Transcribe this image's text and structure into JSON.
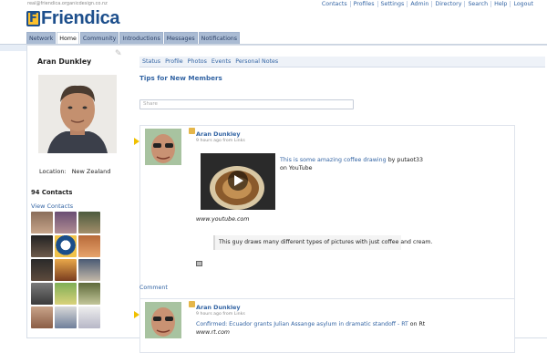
{
  "header": {
    "user_email": "real@friendica.organicdesign.co.nz",
    "logo_letter": "F",
    "logo_text": "Friendica"
  },
  "topnav": [
    "Contacts",
    "Profiles",
    "Settings",
    "Admin",
    "Directory",
    "Search",
    "Help",
    "Logout"
  ],
  "tabs": [
    {
      "label": "Network",
      "active": false
    },
    {
      "label": "Home",
      "active": true
    },
    {
      "label": "Community",
      "active": false
    },
    {
      "label": "Introductions",
      "active": false
    },
    {
      "label": "Messages",
      "active": false
    },
    {
      "label": "Notifications",
      "active": false
    }
  ],
  "profile": {
    "name": "Aran Dunkley",
    "location_label": "Location:",
    "location_value": "New Zealand",
    "contacts_count": "94 Contacts",
    "view_contacts": "View Contacts"
  },
  "subtabs": [
    "Status",
    "Profile",
    "Photos",
    "Events",
    "Personal Notes"
  ],
  "tips": "Tips for New Members",
  "share_placeholder": "Share",
  "posts": [
    {
      "author": "Aran Dunkley",
      "ago": "9 hours ago from Links",
      "video_title": "This is some amazing coffee drawing",
      "video_by": " by putaot33 on YouTube",
      "url": "www.youtube.com",
      "quote": "This guy draws many different types of pictures with just coffee and cream."
    },
    {
      "author": "Aran Dunkley",
      "ago": "9 hours ago from Links",
      "link": "Confirmed: Ecuador grants Julian Assange asylum in dramatic standoff - RT",
      "link_suffix": " on Rt",
      "url": "www.rt.com"
    }
  ],
  "comment_label": "Comment",
  "colors": {
    "accent": "#3465a4",
    "tab": "#aabbd3",
    "logo_yellow": "#fbc02d",
    "logo_blue": "#1d4f8c"
  }
}
